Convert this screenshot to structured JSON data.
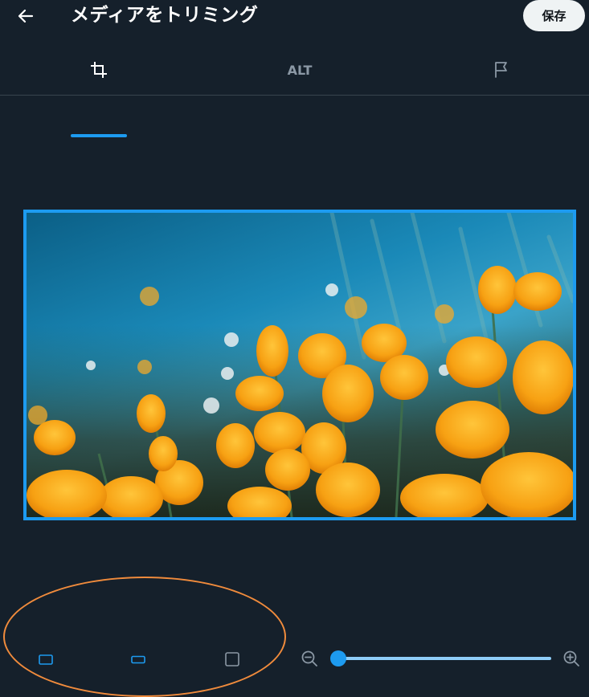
{
  "header": {
    "back_icon": "arrow-left-icon",
    "title": "メディアをトリミング",
    "save_label": "保存"
  },
  "tabs": [
    {
      "icon": "crop-icon",
      "active": true
    },
    {
      "label": "ALT"
    },
    {
      "icon": "flag-icon"
    }
  ],
  "image": {
    "description_icon": "poppy-photo"
  },
  "aspect_ratios": [
    {
      "icon": "original-ratio-icon",
      "selected": true
    },
    {
      "icon": "wide-ratio-icon",
      "selected": true
    },
    {
      "icon": "square-ratio-icon",
      "selected": false
    }
  ],
  "zoom": {
    "minus_icon": "zoom-out-icon",
    "plus_icon": "zoom-in-icon",
    "level": 0
  },
  "colors": {
    "background": "#15202b",
    "accent": "#1d9bf0",
    "annotation": "#f08b3c"
  }
}
